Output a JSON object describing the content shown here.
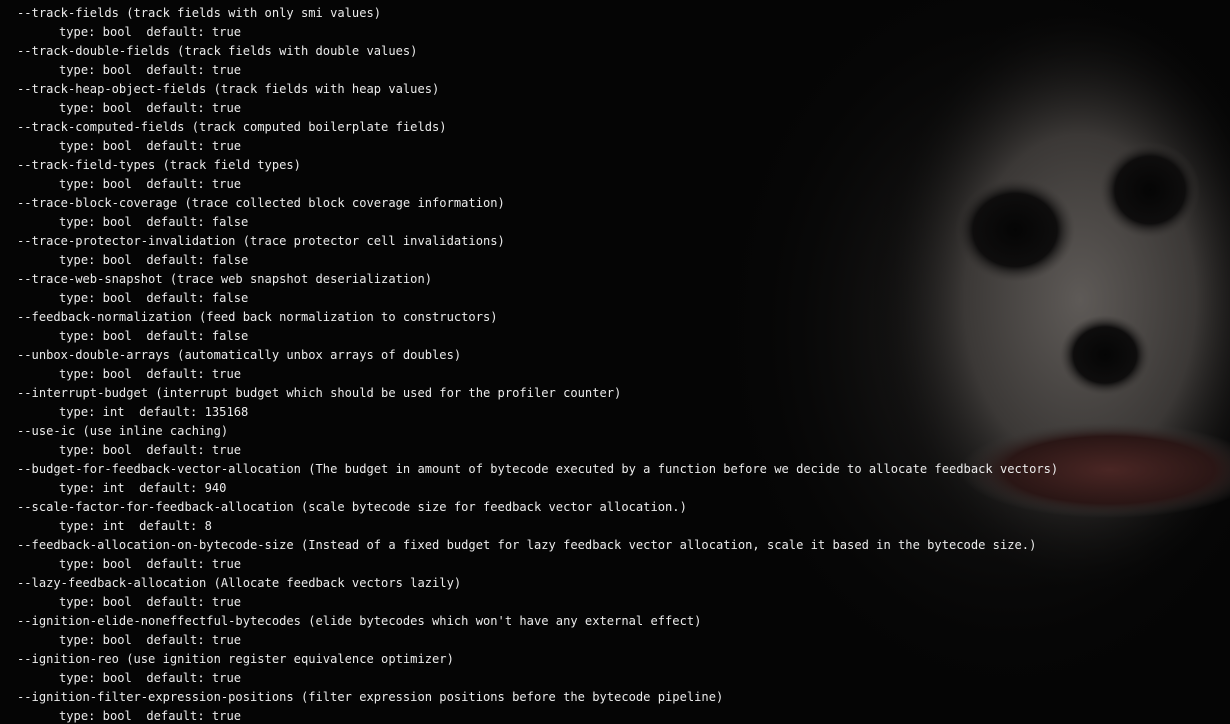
{
  "terminal": {
    "flags": [
      {
        "line": "--track-fields (track fields with only smi values)",
        "detail": "type: bool  default: true"
      },
      {
        "line": "--track-double-fields (track fields with double values)",
        "detail": "type: bool  default: true"
      },
      {
        "line": "--track-heap-object-fields (track fields with heap values)",
        "detail": "type: bool  default: true"
      },
      {
        "line": "--track-computed-fields (track computed boilerplate fields)",
        "detail": "type: bool  default: true"
      },
      {
        "line": "--track-field-types (track field types)",
        "detail": "type: bool  default: true"
      },
      {
        "line": "--trace-block-coverage (trace collected block coverage information)",
        "detail": "type: bool  default: false"
      },
      {
        "line": "--trace-protector-invalidation (trace protector cell invalidations)",
        "detail": "type: bool  default: false"
      },
      {
        "line": "--trace-web-snapshot (trace web snapshot deserialization)",
        "detail": "type: bool  default: false"
      },
      {
        "line": "--feedback-normalization (feed back normalization to constructors)",
        "detail": "type: bool  default: false"
      },
      {
        "line": "--unbox-double-arrays (automatically unbox arrays of doubles)",
        "detail": "type: bool  default: true"
      },
      {
        "line": "--interrupt-budget (interrupt budget which should be used for the profiler counter)",
        "detail": "type: int  default: 135168"
      },
      {
        "line": "--use-ic (use inline caching)",
        "detail": "type: bool  default: true"
      },
      {
        "line": "--budget-for-feedback-vector-allocation (The budget in amount of bytecode executed by a function before we decide to allocate feedback vectors)",
        "detail": "type: int  default: 940"
      },
      {
        "line": "--scale-factor-for-feedback-allocation (scale bytecode size for feedback vector allocation.)",
        "detail": "type: int  default: 8"
      },
      {
        "line": "--feedback-allocation-on-bytecode-size (Instead of a fixed budget for lazy feedback vector allocation, scale it based in the bytecode size.)",
        "detail": "type: bool  default: true"
      },
      {
        "line": "--lazy-feedback-allocation (Allocate feedback vectors lazily)",
        "detail": "type: bool  default: true"
      },
      {
        "line": "--ignition-elide-noneffectful-bytecodes (elide bytecodes which won't have any external effect)",
        "detail": "type: bool  default: true"
      },
      {
        "line": "--ignition-reo (use ignition register equivalence optimizer)",
        "detail": "type: bool  default: true"
      },
      {
        "line": "--ignition-filter-expression-positions (filter expression positions before the bytecode pipeline)",
        "detail": "type: bool  default: true"
      }
    ]
  },
  "colors": {
    "background": "#050505",
    "text": "#ececec"
  },
  "wallpaper": {
    "icon": "portrait-background"
  }
}
